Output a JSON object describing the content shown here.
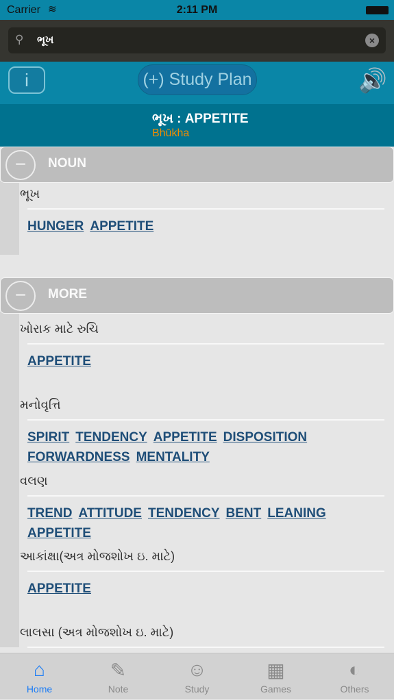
{
  "status": {
    "carrier": "Carrier",
    "time": "2:11 PM"
  },
  "search": {
    "value": "ભૂખ"
  },
  "toolbar": {
    "info": "i",
    "study_plan": "(+) Study Plan"
  },
  "word": {
    "title": "ભૂખ : APPETITE",
    "transliteration": "Bhūkha"
  },
  "sections": [
    {
      "label": "NOUN",
      "entries": [
        {
          "meaning": "ભૂખ",
          "links": [
            "HUNGER",
            "APPETITE"
          ]
        }
      ]
    },
    {
      "label": "MORE",
      "entries": [
        {
          "meaning": "ખોરાક માટે રુચિ",
          "links": [
            "APPETITE"
          ]
        },
        {
          "meaning": "મનોવૃત્તિ",
          "links": [
            "SPIRIT",
            "TENDENCY",
            "APPETITE",
            "DISPOSITION",
            "FORWARDNESS",
            "MENTALITY"
          ]
        },
        {
          "meaning": "વલણ",
          "links": [
            "TREND",
            "ATTITUDE",
            "TENDENCY",
            "BENT",
            "LEANING",
            "APPETITE"
          ]
        },
        {
          "meaning": "આકાંક્ષા(અત્ર મોજશોખ ઇ. માટે)",
          "links": [
            "APPETITE"
          ]
        },
        {
          "meaning": "લાલસા (અત્ર મોજશોખ ઇ. માટે)",
          "links": []
        }
      ]
    }
  ],
  "tabs": [
    {
      "label": "Home",
      "icon": "home-icon",
      "active": true
    },
    {
      "label": "Note",
      "icon": "note-icon"
    },
    {
      "label": "Study",
      "icon": "study-icon"
    },
    {
      "label": "Games",
      "icon": "games-icon"
    },
    {
      "label": "Others",
      "icon": "others-icon"
    }
  ],
  "colors": {
    "accent": "#0a86a7",
    "link": "#1f4e78",
    "transliteration": "#f08c00",
    "active_tab": "#1b7cf5"
  }
}
